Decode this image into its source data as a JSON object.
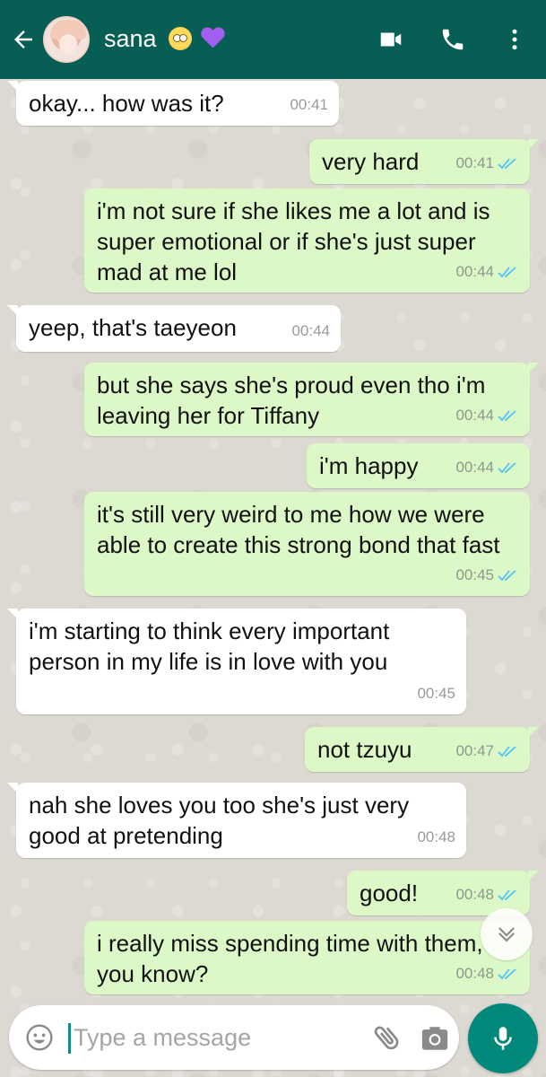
{
  "header": {
    "contact_name": "sana",
    "emoji_1": "face-with-rolling-eyes",
    "emoji_2": "purple-heart",
    "bg_color": "#075e54"
  },
  "messages": [
    {
      "dir": "in",
      "text": "okay... how was it?",
      "time": "00:41"
    },
    {
      "dir": "out",
      "text": "very hard",
      "time": "00:41",
      "status": "read"
    },
    {
      "dir": "out",
      "text": "i'm not sure if she likes me a lot and is super emotional or if she's just super mad at me lol",
      "time": "00:44",
      "status": "read"
    },
    {
      "dir": "in",
      "text": "yeep, that's taeyeon",
      "time": "00:44"
    },
    {
      "dir": "out",
      "text": "but she says she's proud even tho i'm leaving her for Tiffany",
      "time": "00:44",
      "status": "read"
    },
    {
      "dir": "out",
      "text": "i'm happy",
      "time": "00:44",
      "status": "read"
    },
    {
      "dir": "out",
      "text": "it's still very weird to me how we were able to create this strong bond that fast",
      "time": "00:45",
      "status": "read"
    },
    {
      "dir": "in",
      "text": "i'm starting to think every important person in my life is in love with you",
      "time": "00:45"
    },
    {
      "dir": "out",
      "text": "not tzuyu",
      "time": "00:47",
      "status": "read"
    },
    {
      "dir": "in",
      "text": "nah she loves you too she's just very good at pretending",
      "time": "00:48"
    },
    {
      "dir": "out",
      "text": "good!",
      "time": "00:48",
      "status": "read"
    },
    {
      "dir": "out",
      "text": "i really miss spending time with them, you know?",
      "time": "00:48",
      "status": "read"
    }
  ],
  "composer": {
    "placeholder": "Type a message"
  },
  "colors": {
    "incoming_bubble": "#ffffff",
    "outgoing_bubble": "#dcf8c6",
    "read_ticks": "#4fc3f7",
    "mic_button": "#00897b"
  }
}
